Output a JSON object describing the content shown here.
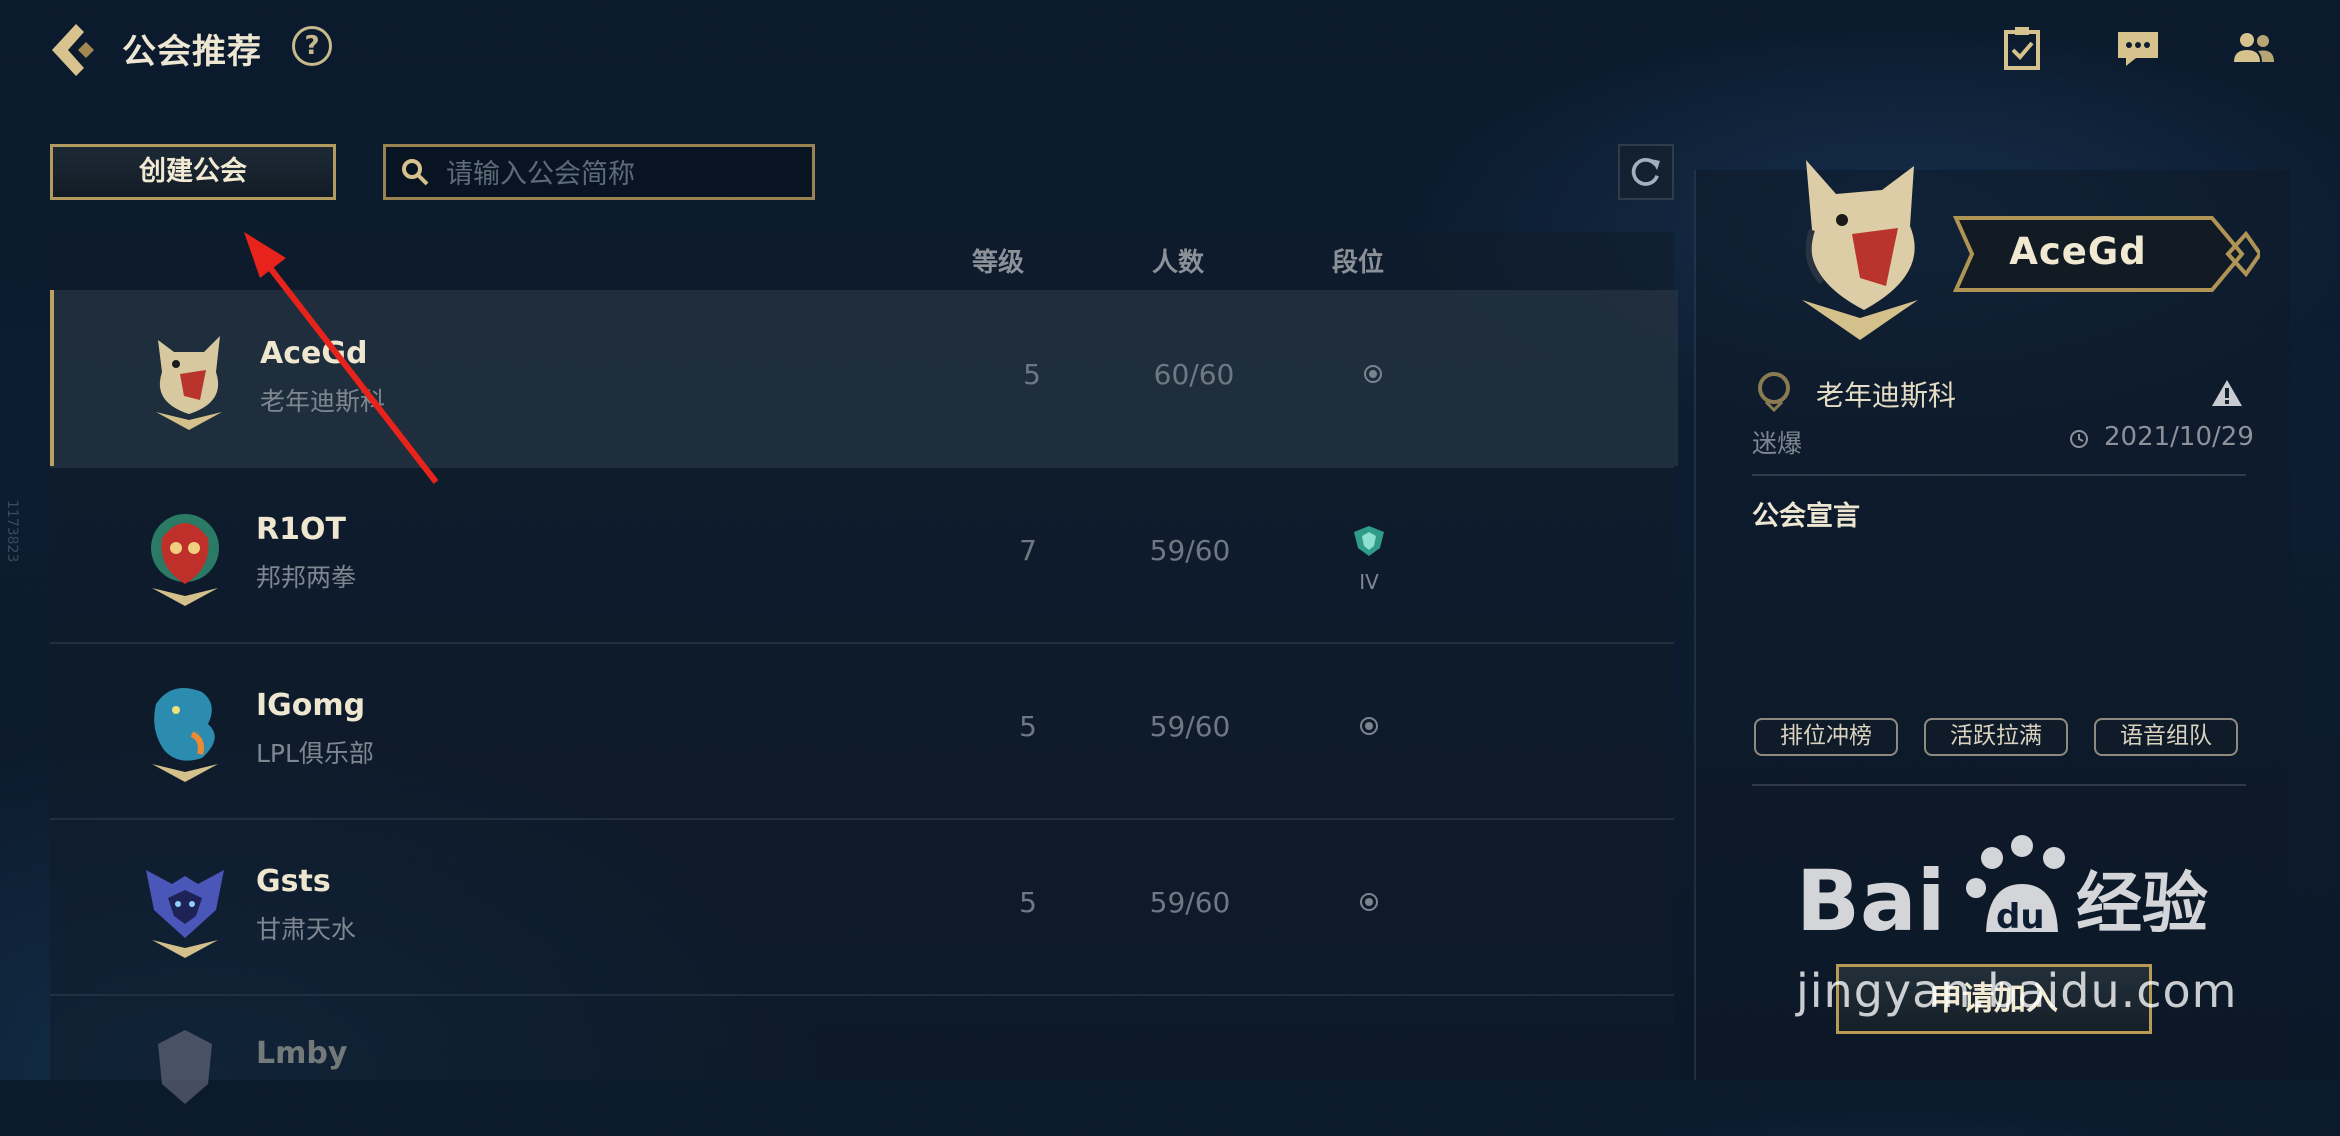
{
  "header": {
    "title": "公会推荐",
    "help_symbol": "?",
    "icons": [
      "task-check-icon",
      "chat-icon",
      "friends-icon"
    ]
  },
  "toolbar": {
    "create_label": "创建公会",
    "search_placeholder": "请输入公会简称"
  },
  "columns": {
    "level": "等级",
    "members": "人数",
    "rank": "段位"
  },
  "guilds": [
    {
      "name": "AceGd",
      "server": "老年迪斯科",
      "level": "5",
      "members": "60/60",
      "rank_icon": "rank-dot-icon",
      "selected": true
    },
    {
      "name": "R1OT",
      "server": "邦邦两拳",
      "level": "7",
      "members": "59/60",
      "rank_icon": "rank-emerald-icon",
      "rank_tier": "IV"
    },
    {
      "name": "IGomg",
      "server": "LPL俱乐部",
      "level": "5",
      "members": "59/60",
      "rank_icon": "rank-dot-icon"
    },
    {
      "name": "Gsts",
      "server": "甘肃天水",
      "level": "5",
      "members": "59/60",
      "rank_icon": "rank-dot-icon"
    },
    {
      "name": "Lmby",
      "server": "",
      "level": "",
      "members": "",
      "rank_icon": ""
    }
  ],
  "detail": {
    "name": "AceGd",
    "server": "老年迪斯科",
    "owner": "迷爆",
    "date": "2021/10/29",
    "declaration_label": "公会宣言",
    "tags": [
      "排位冲榜",
      "活跃拉满",
      "语音组队"
    ],
    "apply_label": "申请加入"
  },
  "watermark": {
    "brand": "Bai du 经验",
    "url": "jingyan.baidu.com"
  },
  "colors": {
    "accent_gold": "#c0a062",
    "background": "#0b1a2c"
  }
}
